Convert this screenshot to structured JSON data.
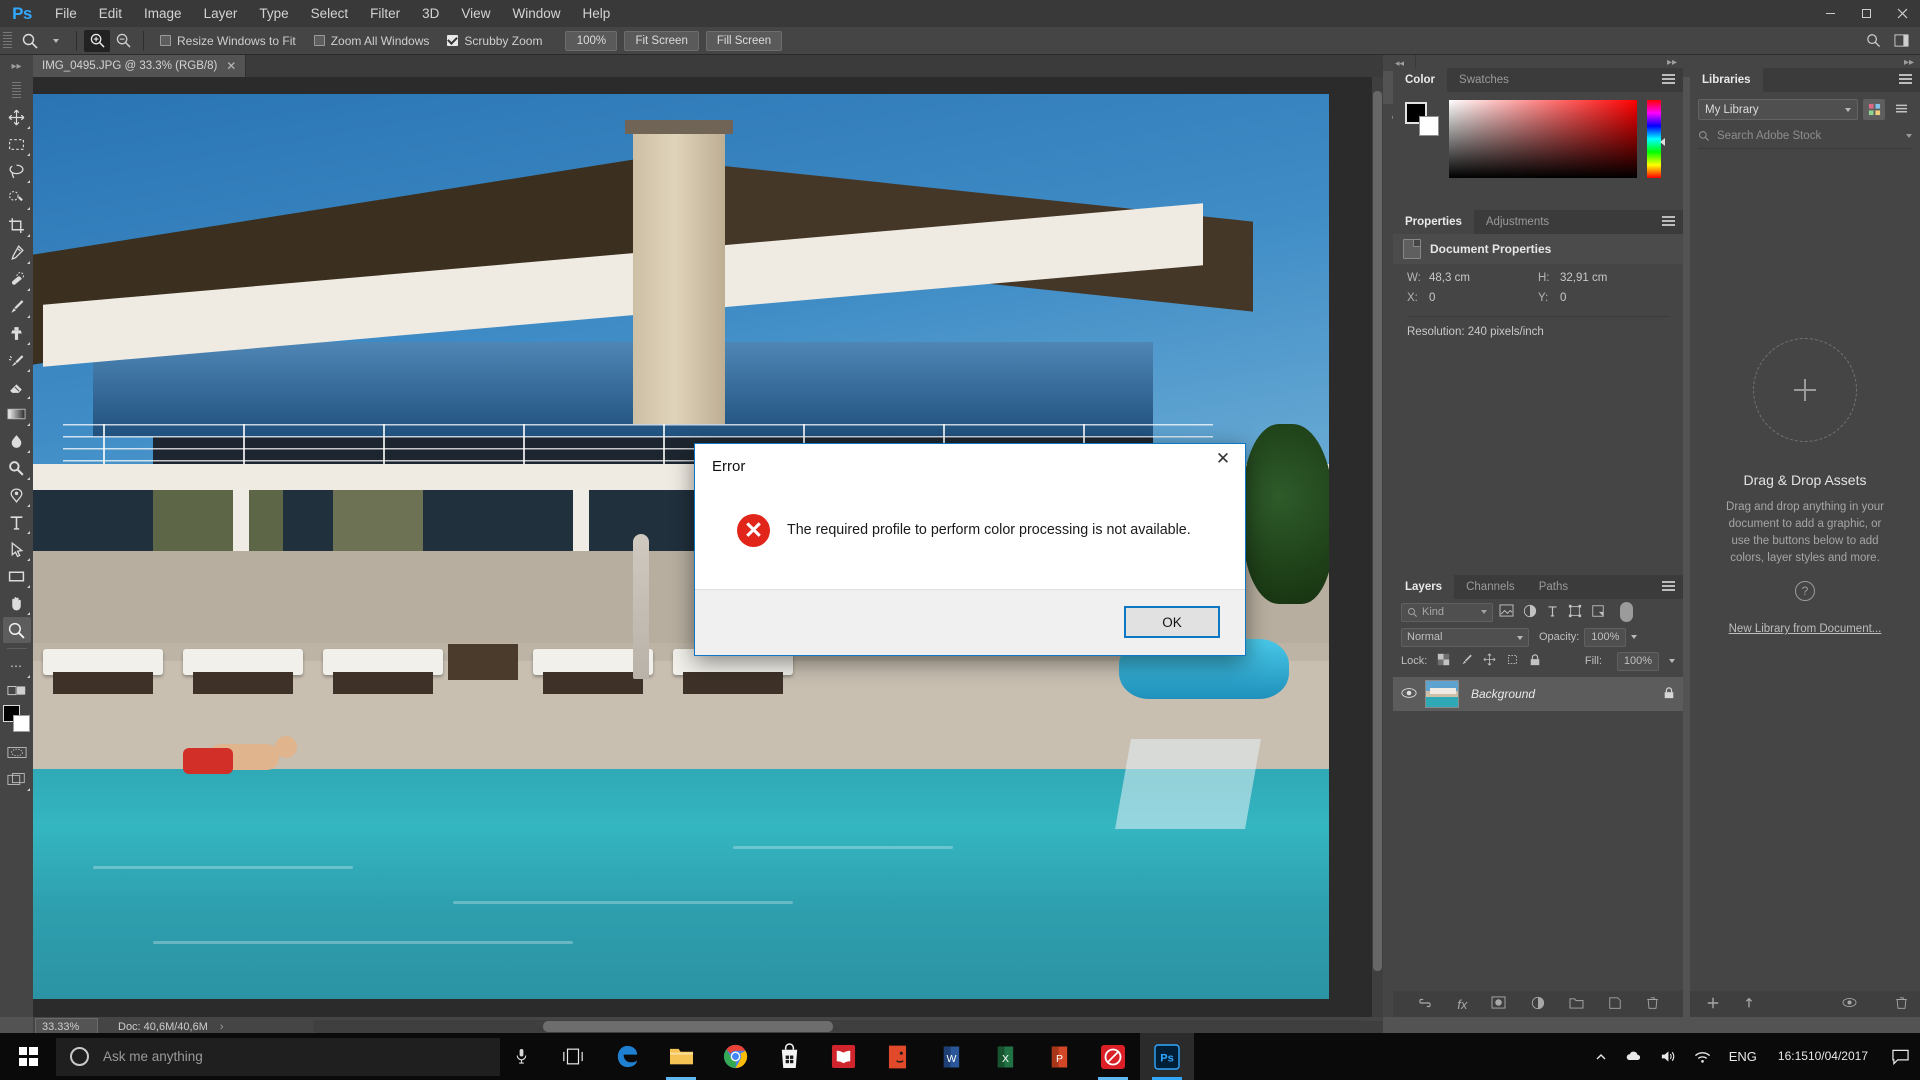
{
  "app": {
    "name": "Adobe Photoshop",
    "logo": "Ps"
  },
  "menubar": {
    "items": [
      "File",
      "Edit",
      "Image",
      "Layer",
      "Type",
      "Select",
      "Filter",
      "3D",
      "View",
      "Window",
      "Help"
    ],
    "window_controls": {
      "minimize": "—",
      "maximize": "❐",
      "close": "✕"
    }
  },
  "options_bar": {
    "tool": "zoom-tool",
    "zoom_in_label": "Zoom In",
    "zoom_out_label": "Zoom Out",
    "checkboxes": [
      {
        "label": "Resize Windows to Fit",
        "checked": false
      },
      {
        "label": "Zoom All Windows",
        "checked": false
      },
      {
        "label": "Scrubby Zoom",
        "checked": true
      }
    ],
    "buttons": [
      "100%",
      "Fit Screen",
      "Fill Screen"
    ]
  },
  "document_tab": {
    "title": "IMG_0495.JPG @ 33.3% (RGB/8)",
    "close": "✕"
  },
  "toolbar": {
    "tools": [
      "move-tool",
      "marquee-tool",
      "lasso-tool",
      "quick-selection-tool",
      "crop-tool",
      "eyedropper-tool",
      "healing-brush-tool",
      "brush-tool",
      "clone-stamp-tool",
      "history-brush-tool",
      "eraser-tool",
      "gradient-tool",
      "blur-tool",
      "dodge-tool",
      "pen-tool",
      "type-tool",
      "path-selection-tool",
      "rectangle-tool",
      "hand-tool",
      "zoom-tool"
    ],
    "active_tool": "zoom-tool",
    "more_tools": "•••",
    "foreground_color": "#000000",
    "background_color": "#ffffff"
  },
  "status_bar": {
    "zoom": "33.33%",
    "doc": "Doc: 40,6M/40,6M"
  },
  "panels": {
    "color": {
      "tabs": [
        "Color",
        "Swatches"
      ],
      "active_tab": "Color",
      "foreground": "#000000",
      "background": "#ffffff"
    },
    "properties": {
      "tabs": [
        "Properties",
        "Adjustments"
      ],
      "active_tab": "Properties",
      "header": "Document Properties",
      "fields": [
        {
          "label": "W:",
          "value": "48,3 cm"
        },
        {
          "label": "H:",
          "value": "32,91 cm"
        },
        {
          "label": "X:",
          "value": "0"
        },
        {
          "label": "Y:",
          "value": "0"
        }
      ],
      "resolution": "Resolution: 240 pixels/inch"
    },
    "layers": {
      "tabs": [
        "Layers",
        "Channels",
        "Paths"
      ],
      "active_tab": "Layers",
      "filter_placeholder": "Kind",
      "blend_mode": "Normal",
      "opacity_label": "Opacity:",
      "opacity_value": "100%",
      "lock_label": "Lock:",
      "fill_label": "Fill:",
      "fill_value": "100%",
      "rows": [
        {
          "name": "Background",
          "visible": true,
          "locked": true
        }
      ],
      "bottom_icons": [
        "link-icon",
        "fx-icon",
        "layer-mask-icon",
        "adjustment-layer-icon",
        "new-group-icon",
        "new-layer-icon",
        "delete-layer-icon"
      ]
    },
    "libraries": {
      "tabs": [
        "Libraries"
      ],
      "active_tab": "Libraries",
      "selected_library": "My Library",
      "search_placeholder": "Search Adobe Stock",
      "dropzone_title": "Drag & Drop Assets",
      "dropzone_text": "Drag and drop anything in your document to add a graphic, or use the buttons below to add colors, layer styles and more.",
      "help": "?",
      "new_library_link": "New Library from Document..."
    }
  },
  "dialog": {
    "title": "Error",
    "close": "✕",
    "icon": "error-icon",
    "icon_color": "#e1251b",
    "message": "The required profile to perform color processing is not available.",
    "ok_label": "OK",
    "accent_color": "#0e77c4"
  },
  "taskbar": {
    "start": "start-button",
    "search_placeholder": "Ask me anything",
    "mic": "microphone-icon",
    "task_view": "task-view-icon",
    "apps": [
      {
        "name": "microsoft-edge",
        "label": "Microsoft Edge",
        "running": false
      },
      {
        "name": "file-explorer",
        "label": "File Explorer",
        "running": true
      },
      {
        "name": "google-chrome",
        "label": "Google Chrome",
        "running": false
      },
      {
        "name": "microsoft-store",
        "label": "Microsoft Store",
        "running": false
      },
      {
        "name": "books-app",
        "label": "Books",
        "running": false
      },
      {
        "name": "mail-app",
        "label": "Mail",
        "running": false
      },
      {
        "name": "microsoft-word",
        "label": "Word",
        "running": false
      },
      {
        "name": "microsoft-excel",
        "label": "Excel",
        "running": false
      },
      {
        "name": "microsoft-powerpoint",
        "label": "PowerPoint",
        "running": false
      },
      {
        "name": "creative-cloud",
        "label": "Adobe Creative Cloud",
        "running": true
      },
      {
        "name": "adobe-photoshop",
        "label": "Adobe Photoshop",
        "running": true
      }
    ],
    "tray": {
      "language": "ENG",
      "time": "16:15",
      "date": "10/04/2017"
    }
  }
}
